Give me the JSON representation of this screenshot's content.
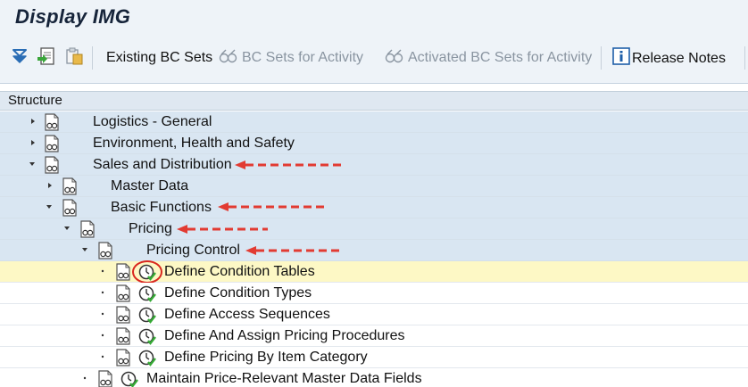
{
  "window": {
    "title": "Display IMG"
  },
  "toolbar": {
    "icons": [
      "expand-all-icon",
      "open-document-icon",
      "paste-icon",
      "bc-sets-icon",
      "info-icon"
    ],
    "existing_bc_sets": "Existing BC Sets",
    "bc_sets_for_activity": "BC Sets for Activity",
    "activated_bc_sets": "Activated BC Sets for Activity",
    "release_notes": "Release Notes"
  },
  "tree": {
    "header": "Structure",
    "rows": [
      {
        "label": "Logistics - General",
        "state": "collapsed"
      },
      {
        "label": "Environment, Health and Safety",
        "state": "collapsed"
      },
      {
        "label": "Sales and Distribution",
        "state": "expanded"
      },
      {
        "label": "Master Data",
        "state": "collapsed"
      },
      {
        "label": "Basic Functions",
        "state": "expanded"
      },
      {
        "label": "Pricing",
        "state": "expanded"
      },
      {
        "label": "Pricing Control",
        "state": "expanded"
      },
      {
        "label": "Define Condition Tables",
        "state": "leaf",
        "selected": true
      },
      {
        "label": "Define Condition Types",
        "state": "leaf"
      },
      {
        "label": "Define Access Sequences",
        "state": "leaf"
      },
      {
        "label": "Define And Assign Pricing Procedures",
        "state": "leaf"
      },
      {
        "label": "Define Pricing By Item Category",
        "state": "leaf"
      },
      {
        "label": "Maintain Price-Relevant Master Data Fields",
        "state": "leaf"
      }
    ]
  },
  "colors": {
    "node_background": "#d9e6f2",
    "selected_background": "#fdf8c5",
    "annotation": "#e23b32"
  }
}
